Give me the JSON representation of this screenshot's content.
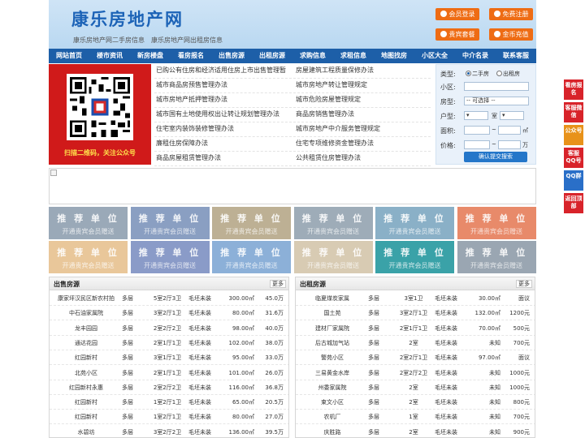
{
  "header": {
    "brand": "康乐房地产网",
    "tagline_sale": "康乐房地产网二手房信息",
    "tagline_rent": "康乐房地产网出租房信息",
    "buttons": {
      "login": "会员登录",
      "register": "免费注册",
      "vip": "贵宾套餐",
      "coins": "金币充值"
    }
  },
  "nav": [
    "网站首页",
    "楼市资讯",
    "新房楼盘",
    "看房报名",
    "出售房源",
    "出租房源",
    "求购信息",
    "求租信息",
    "地图找房",
    "小区大全",
    "中介名录",
    "联系客服"
  ],
  "qr": {
    "caption": "扫描二维码，关注公众号"
  },
  "news": [
    [
      "已购公有住房和经济适用住房上市出售管理暂",
      "房屋建筑工程质量保修办法"
    ],
    [
      "城市商品房预售管理办法",
      "城市房地产转让管理规定"
    ],
    [
      "城市房地产抵押管理办法",
      "城市危险房屋管理规定"
    ],
    [
      "城市国有土地使用权出让转让规划管理办法",
      "商品房销售管理办法"
    ],
    [
      "住宅室内装饰装修管理办法",
      "城市房地产中介服务管理规定"
    ],
    [
      "廉租住房保障办法",
      "住宅专项维修资金管理办法"
    ],
    [
      "商品房屋租赁管理办法",
      "公共租赁住房管理办法"
    ]
  ],
  "search": {
    "type_label": "类型:",
    "opt_sale": "二手房",
    "opt_rent": "出租房",
    "community_label": "小区:",
    "layout_label": "房型:",
    "layout_value": "-- 可选择 --",
    "unit_label": "户型:",
    "room_unit": "室",
    "area_label": "面积:",
    "area_unit": "㎡",
    "price_label": "价格:",
    "price_unit": "万",
    "tilde": "~",
    "submit": "确认提交搜索"
  },
  "recommend": {
    "title": "推 荐 单 位",
    "subtitle": "开通贵宾会员赠送",
    "colors": [
      "#9aa9b8",
      "#8a9fc2",
      "#bdb094",
      "#9eacb8",
      "#8ab0c7",
      "#e88a6a",
      "#e9c79a",
      "#8a9bc8",
      "#8cb0d8",
      "#d8cbb3",
      "#3aa2a8",
      "#9aa6b2"
    ]
  },
  "sale_panel": {
    "title": "出售房源",
    "more": "更多",
    "rows": [
      [
        "康家坪汉民区新农村拍",
        "多层",
        "5室2厅3卫",
        "毛坯未装",
        "300.00㎡",
        "45.0万"
      ],
      [
        "中石油家属院",
        "多层",
        "3室2厅1卫",
        "毛坯未装",
        "80.00㎡",
        "31.6万"
      ],
      [
        "龙丰园园",
        "多层",
        "2室2厅2卫",
        "毛坯未装",
        "98.00㎡",
        "40.0万"
      ],
      [
        "通达花园",
        "多层",
        "2室1厅1卫",
        "毛坯未装",
        "102.00㎡",
        "38.0万"
      ],
      [
        "红园新村",
        "多层",
        "3室1厅1卫",
        "毛坯未装",
        "95.00㎡",
        "33.0万"
      ],
      [
        "北苑小区",
        "多层",
        "2室1厅1卫",
        "毛坯未装",
        "101.00㎡",
        "26.0万"
      ],
      [
        "红园新村永惠",
        "多层",
        "2室2厅2卫",
        "毛坯未装",
        "116.00㎡",
        "36.8万"
      ],
      [
        "红园新村",
        "多层",
        "1室2厅1卫",
        "毛坯未装",
        "65.00㎡",
        "20.5万"
      ],
      [
        "红园新村",
        "多层",
        "1室2厅1卫",
        "毛坯未装",
        "80.00㎡",
        "27.0万"
      ],
      [
        "水碧坊",
        "多层",
        "3室2厅2卫",
        "毛坯未装",
        "136.00㎡",
        "39.5万"
      ]
    ]
  },
  "rent_panel": {
    "title": "出租房源",
    "more": "更多",
    "rows": [
      [
        "临夏煤炭家属",
        "多层",
        "3室1卫",
        "毛坯未装",
        "30.00㎡",
        "面议"
      ],
      [
        "国土苑",
        "多层",
        "3室2厅1卫",
        "毛坯未装",
        "132.00㎡",
        "1200元"
      ],
      [
        "建材厂家属院",
        "多层",
        "2室1厅1卫",
        "毛坯未装",
        "70.00㎡",
        "500元"
      ],
      [
        "后古城加气站",
        "多层",
        "2室",
        "毛坯未装",
        "未知",
        "700元"
      ],
      [
        "警苑小区",
        "多层",
        "2室2厅1卫",
        "毛坯未装",
        "97.00㎡",
        "面议"
      ],
      [
        "三易黄金水岸",
        "多层",
        "2室2厅2卫",
        "毛坯未装",
        "未知",
        "1000元"
      ],
      [
        "州委家属院",
        "多层",
        "2室",
        "毛坯未装",
        "未知",
        "1000元"
      ],
      [
        "束文小区",
        "多层",
        "2室",
        "毛坯未装",
        "未知",
        "800元"
      ],
      [
        "农机厂",
        "多层",
        "1室",
        "毛坯未装",
        "未知",
        "700元"
      ],
      [
        "庆胜路",
        "多层",
        "2室",
        "毛坯未装",
        "未知",
        "900元"
      ]
    ]
  },
  "float": [
    {
      "label": "看房报名",
      "color": "#d8232a"
    },
    {
      "label": "客服微信",
      "color": "#d8232a"
    },
    {
      "label": "公众号",
      "color": "#e8921a"
    },
    {
      "label": "客服QQ号",
      "color": "#d8232a"
    },
    {
      "label": "QQ群",
      "color": "#2a6fc8"
    },
    {
      "label": "返回顶部",
      "color": "#d8232a"
    }
  ]
}
